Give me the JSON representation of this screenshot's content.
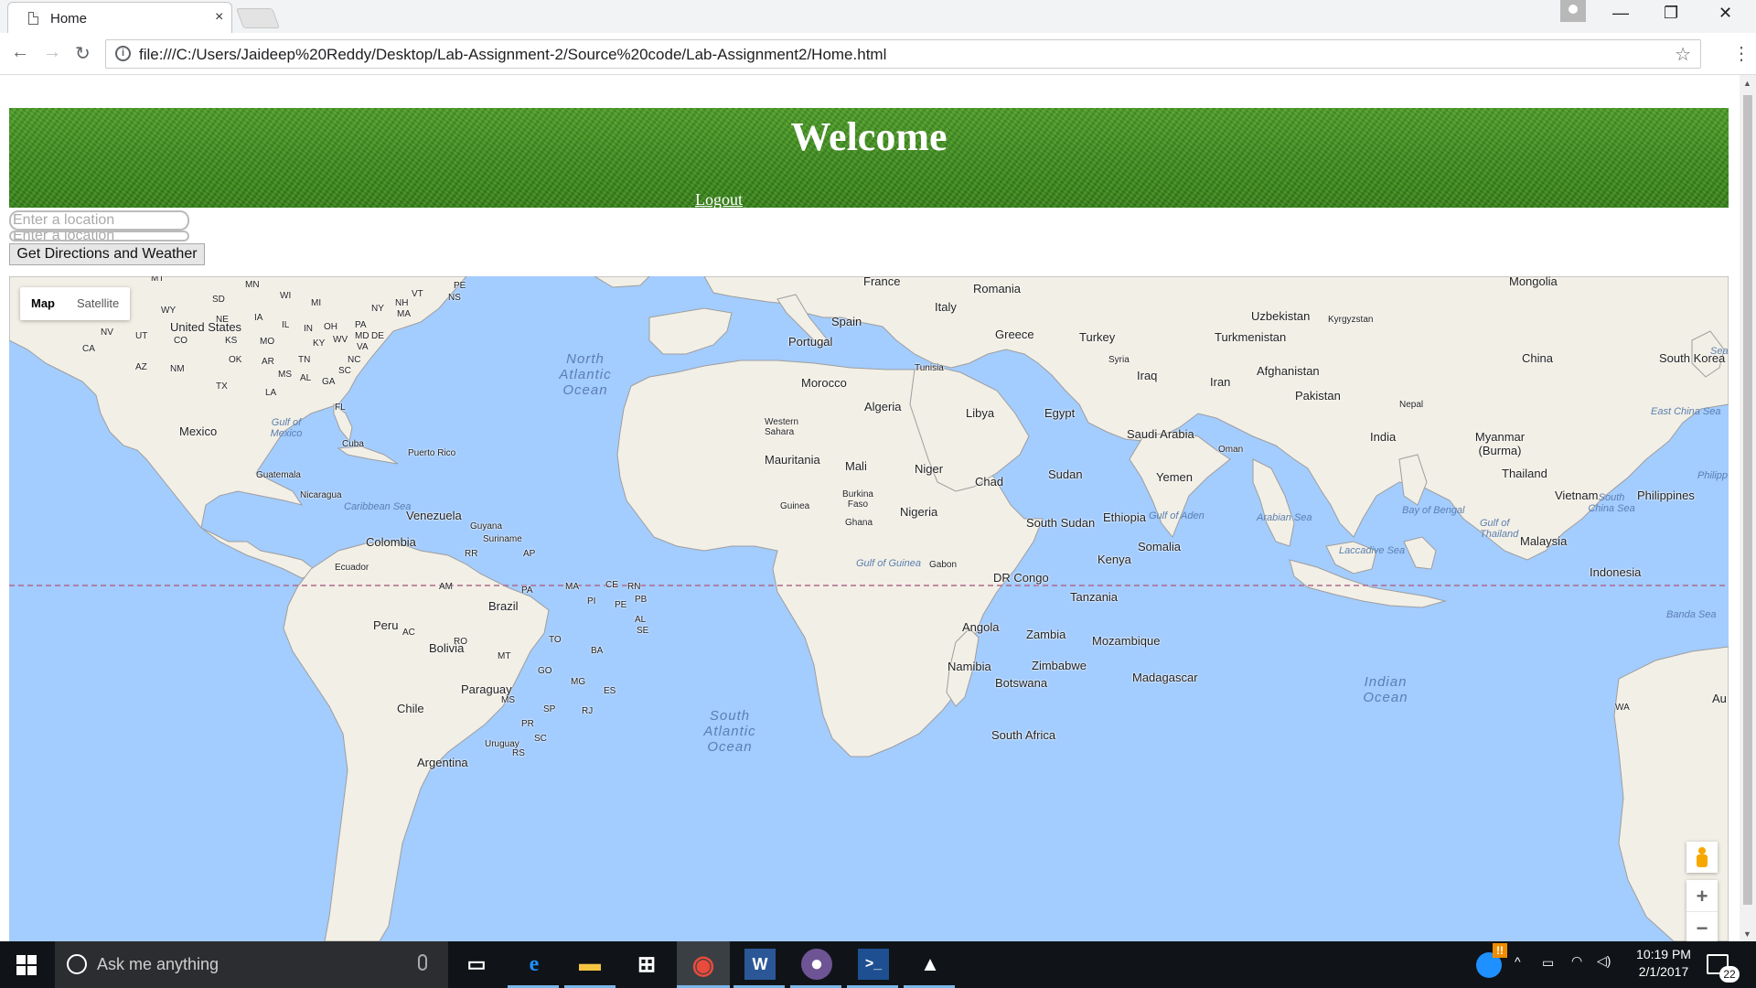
{
  "browser": {
    "tab_title": "Home",
    "tab_close": "×",
    "url": "file:///C:/Users/Jaideep%20Reddy/Desktop/Lab-Assignment-2/Source%20code/Lab-Assignment2/Home.html",
    "window_controls": {
      "minimize": "—",
      "restore": "❐",
      "close": "✕"
    }
  },
  "page": {
    "heading": "Welcome",
    "logout_link": "Logout",
    "origin_placeholder": "Enter a location",
    "destination_placeholder": "Enter a location",
    "submit_button": "Get Directions and Weather"
  },
  "map": {
    "type_buttons": [
      "Map",
      "Satellite"
    ],
    "active_type": "Map",
    "zoom_in": "+",
    "zoom_out": "−",
    "colors": {
      "water": "#a3ccff",
      "land": "#f2efe6",
      "equator": "#b06a8a"
    },
    "oceans": [
      "North Atlantic Ocean",
      "South Atlantic Ocean",
      "Indian Ocean"
    ],
    "seas": [
      "Gulf of Mexico",
      "Caribbean Sea",
      "Gulf of Guinea",
      "Gulf of Aden",
      "Arabian Sea",
      "Bay of Bengal",
      "Laccadive Sea",
      "Gulf of Thailand",
      "South China Sea",
      "East China Sea",
      "Banda Sea",
      "Philipp",
      "Sea"
    ],
    "countries": [
      "France",
      "Romania",
      "Mongolia",
      "Italy",
      "Spain",
      "Portugal",
      "Greece",
      "Turkey",
      "Uzbekistan",
      "Kyrgyzstan",
      "Turkmenistan",
      "China",
      "South Korea",
      "Syria",
      "Iraq",
      "Iran",
      "Afghanistan",
      "Tunisia",
      "Morocco",
      "Pakistan",
      "Nepal",
      "Algeria",
      "Libya",
      "Egypt",
      "Western Sahara",
      "Saudi Arabia",
      "India",
      "Oman",
      "Myanmar (Burma)",
      "Mauritania",
      "Mali",
      "Niger",
      "Sudan",
      "Chad",
      "Yemen",
      "Thailand",
      "Burkina Faso",
      "Guinea",
      "Nigeria",
      "Vietnam",
      "Philippines",
      "Ghana",
      "South Sudan",
      "Ethiopia",
      "Malaysia",
      "Somalia",
      "Gabon",
      "Kenya",
      "DR Congo",
      "Indonesia",
      "Tanzania",
      "Angola",
      "Zambia",
      "Mozambique",
      "Namibia",
      "Zimbabwe",
      "Madagascar",
      "Botswana",
      "South Africa",
      "United States",
      "Mexico",
      "Cuba",
      "Puerto Rico",
      "Guatemala",
      "Nicaragua",
      "Venezuela",
      "Guyana",
      "Suriname",
      "Colombia",
      "Ecuador",
      "Brazil",
      "Peru",
      "Bolivia",
      "Paraguay",
      "Chile",
      "Uruguay",
      "Argentina",
      "WA",
      "Au"
    ],
    "us_states": [
      "MT",
      "MN",
      "WI",
      "MI",
      "NY",
      "NH",
      "VT",
      "PE",
      "NS",
      "SD",
      "WY",
      "NE",
      "IA",
      "IL",
      "IN",
      "OH",
      "PA",
      "MA",
      "NV",
      "UT",
      "CO",
      "KS",
      "MO",
      "KY",
      "WV",
      "MD",
      "DE",
      "VA",
      "CA",
      "OK",
      "AR",
      "TN",
      "NC",
      "AZ",
      "NM",
      "MS",
      "AL",
      "GA",
      "SC",
      "TX",
      "LA",
      "FL"
    ],
    "brazil_states": [
      "RR",
      "AP",
      "AM",
      "PA",
      "MA",
      "CE",
      "RN",
      "PB",
      "PI",
      "PE",
      "AC",
      "RO",
      "TO",
      "AL",
      "SE",
      "MT",
      "BA",
      "GO",
      "MG",
      "ES",
      "MS",
      "SP",
      "RJ",
      "PR",
      "SC",
      "RS"
    ]
  },
  "taskbar": {
    "search_placeholder": "Ask me anything",
    "time": "10:19 PM",
    "date": "2/1/2017",
    "notification_count": "22"
  }
}
